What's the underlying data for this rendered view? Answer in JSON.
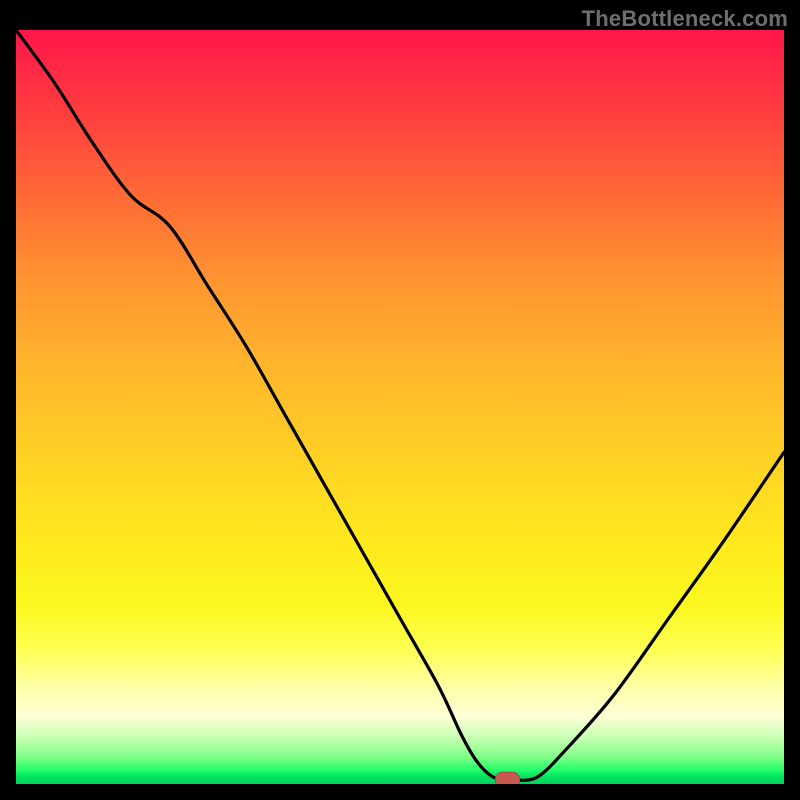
{
  "watermark": "TheBottleneck.com",
  "colors": {
    "background": "#000000",
    "curve": "#000000",
    "marker": "#c65a50",
    "watermark": "#6e6e6e"
  },
  "chart_data": {
    "type": "line",
    "title": "",
    "xlabel": "",
    "ylabel": "",
    "xlim": [
      0,
      100
    ],
    "ylim": [
      0,
      100
    ],
    "x": [
      0,
      5,
      10,
      15,
      20,
      25,
      30,
      35,
      40,
      45,
      50,
      55,
      58,
      60,
      62,
      64,
      65,
      68,
      72,
      78,
      85,
      92,
      100
    ],
    "values": [
      100,
      93,
      85,
      78,
      74,
      66,
      58,
      49,
      40,
      31,
      22,
      13,
      6.5,
      3,
      1,
      0.5,
      0.5,
      1,
      5,
      12,
      22,
      32,
      44
    ],
    "marker": {
      "x": 64,
      "y": 0.5
    },
    "note": "Values read off the gradient-backed plot area as approximate percentages of full height; bottom edge = 0, top edge = 100. Axes in image are unlabeled, so x is treated as 0–100 left→right."
  }
}
